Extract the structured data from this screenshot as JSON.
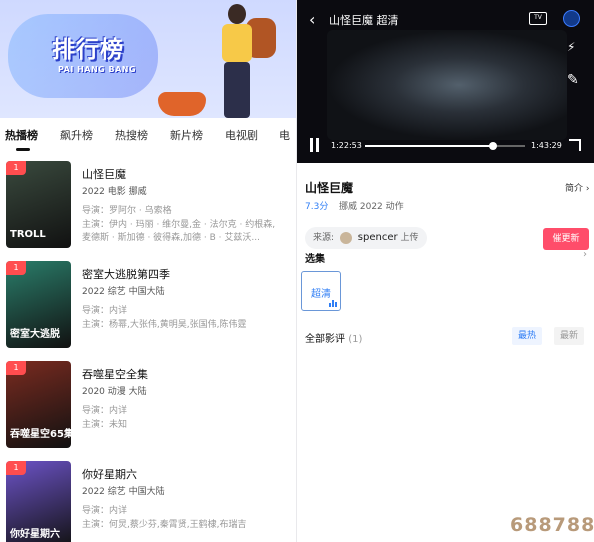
{
  "banner": {
    "title": "排行榜",
    "subtitle": "PAI HANG BANG"
  },
  "tabs": [
    "热播榜",
    "飙升榜",
    "热搜榜",
    "新片榜",
    "电视剧",
    "电"
  ],
  "items": [
    {
      "rank": "1",
      "title": "山怪巨魔",
      "meta": "2022  电影  挪威",
      "director": "导演：罗阿尔 · 乌索格",
      "cast": "主演：伊内 · 玛丽 · 维尔曼,金 · 法尔克 · 约根森,麦德斯 · 斯加德 · 彼得森,加德 · B · 艾兹沃...",
      "poster_caption": "TROLL",
      "poster_color": "#3a4a3e"
    },
    {
      "rank": "1",
      "title": "密室大逃脱第四季",
      "meta": "2022  综艺  中国大陆",
      "director": "导演：内详",
      "cast": "主演：杨幂,大张伟,黄明昊,张国伟,陈伟霆",
      "poster_caption": "密室大逃脱",
      "poster_color": "#2a7d6a"
    },
    {
      "rank": "1",
      "title": "吞噬星空全集",
      "meta": "2020  动漫  大陆",
      "director": "导演：内详",
      "cast": "主演：未知",
      "poster_caption": "吞噬星空65集",
      "poster_color": "#7a2b20"
    },
    {
      "rank": "1",
      "title": "你好星期六",
      "meta": "2022  综艺  中国大陆",
      "director": "导演：内详",
      "cast": "主演：何炅,蔡少芬,秦霄贤,王鹤棣,布瑞吉",
      "poster_caption": "你好星期六",
      "poster_color": "#6c53c7"
    }
  ],
  "player": {
    "title": "山怪巨魔 超清",
    "current_time": "1:22:53",
    "total_time": "1:43:29",
    "progress": 0.8,
    "tv_label": "TV"
  },
  "detail": {
    "title": "山怪巨魔",
    "intro": "简介 ›",
    "score": "7.3分",
    "meta": "挪威  2022  动作",
    "source_label": "来源:",
    "source_name": "spencer",
    "source_action": "上传",
    "urge_label": "催更新",
    "episodes_label": "选集",
    "quality": "超清",
    "reviews_label": "全部影评",
    "reviews_count": "(1)",
    "sort_hot": "最热",
    "sort_new": "最新"
  },
  "watermark": "688788",
  "colors": {
    "accent_blue": "#2f7ef5",
    "urge_red": "#ff4d6a",
    "rank_red": "#ff4d4f"
  }
}
